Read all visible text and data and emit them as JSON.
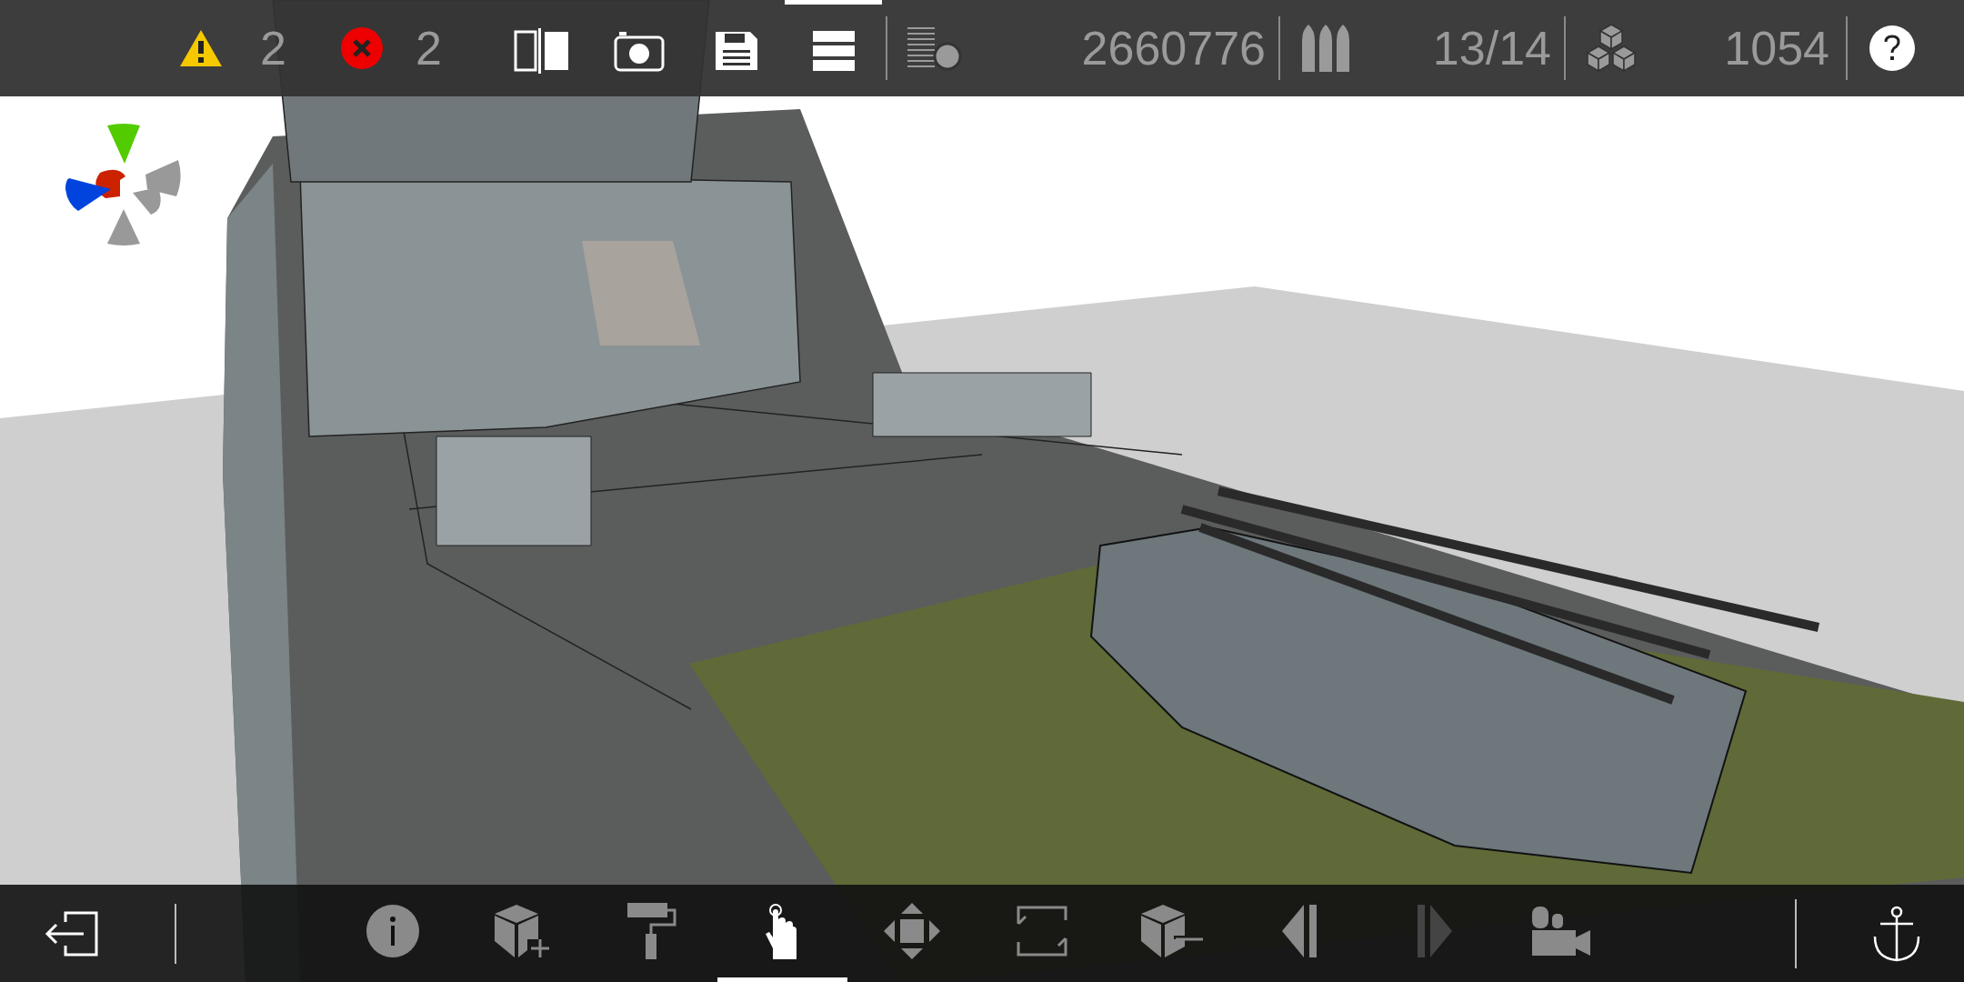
{
  "top_bar": {
    "warning_count": "2",
    "error_count": "2",
    "tools": [
      {
        "kind": "split",
        "selected": false
      },
      {
        "kind": "camera",
        "selected": false
      },
      {
        "kind": "save",
        "selected": false
      },
      {
        "kind": "menu",
        "selected": true
      }
    ],
    "stats": [
      {
        "kind": "polygons",
        "value": "2660776"
      },
      {
        "kind": "parts",
        "value": "13/14"
      },
      {
        "kind": "blocks",
        "value": "1054"
      }
    ]
  },
  "bottom_bar": {
    "tools": [
      {
        "kind": "info",
        "selected": false,
        "disabled": false
      },
      {
        "kind": "add-block",
        "selected": false,
        "disabled": false
      },
      {
        "kind": "paint",
        "selected": false,
        "disabled": false
      },
      {
        "kind": "hand",
        "selected": true,
        "disabled": false
      },
      {
        "kind": "move",
        "selected": false,
        "disabled": false
      },
      {
        "kind": "fit",
        "selected": false,
        "disabled": false
      },
      {
        "kind": "remove-block",
        "selected": false,
        "disabled": false
      },
      {
        "kind": "undo",
        "selected": false,
        "disabled": false
      },
      {
        "kind": "redo",
        "selected": false,
        "disabled": true
      },
      {
        "kind": "camera-view",
        "selected": false,
        "disabled": false
      }
    ]
  }
}
